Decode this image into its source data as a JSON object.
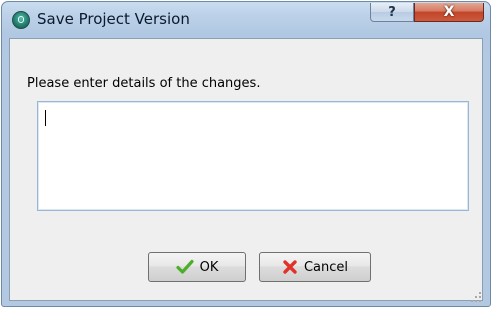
{
  "window": {
    "title": "Save Project Version",
    "help_label": "?",
    "close_label": "X"
  },
  "form": {
    "prompt": "Please enter details of the changes.",
    "details_value": ""
  },
  "buttons": {
    "ok_label": "OK",
    "cancel_label": "Cancel"
  },
  "icons": {
    "app": "app-icon",
    "ok": "checkmark-icon",
    "cancel": "red-x-icon"
  },
  "colors": {
    "title_bar": "#bcd1e8",
    "close_button": "#c2452a",
    "dialog_body": "#efefef",
    "ok_check": "#4caf2a",
    "cancel_x": "#e0322a"
  }
}
